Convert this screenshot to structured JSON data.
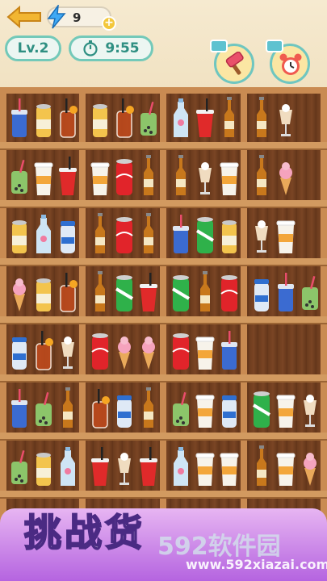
{
  "hud": {
    "energy_count": "9",
    "energy_plus": "+",
    "level": "Lv.2",
    "timer": "9:55"
  },
  "banner": {
    "title": "挑战货",
    "watermark": "592软件园",
    "watermark_url": "www.592xiazai.com"
  },
  "colors": {
    "accent_teal": "#73c9b9",
    "shelf_wood": "#c98b52",
    "banner_purple": "#b564e0"
  },
  "rows": [
    [
      "soda-cup-blue",
      "juice-can",
      "orange-jar",
      "juice-can",
      "orange-jar",
      "matcha-cup",
      "milk-bottle",
      "red-cup",
      "beer-bottle",
      "beer-bottle",
      "latte-glass"
    ],
    [
      "matcha-cup",
      "coffee-cup",
      "red-cup",
      "coffee-cup",
      "cola-can",
      "beer-bottle",
      "beer-bottle",
      "latte-glass",
      "coffee-cup",
      "beer-bottle",
      "icecream-cone"
    ],
    [
      "juice-can",
      "milk-bottle",
      "milk-jar",
      "beer-bottle",
      "cola-can",
      "beer-bottle",
      "soda-cup-blue",
      "green-can",
      "juice-can",
      "latte-glass",
      "coffee-cup"
    ],
    [
      "icecream-cone",
      "juice-can",
      "orange-jar",
      "beer-bottle",
      "green-can",
      "red-cup",
      "green-can",
      "beer-bottle",
      "cola-can",
      "milk-jar",
      "soda-cup-blue",
      "matcha-cup"
    ],
    [
      "milk-jar",
      "orange-jar",
      "latte-glass",
      "cola-can",
      "icecream-cone",
      "icecream-cone",
      "cola-can",
      "coffee-cup",
      "soda-cup-blue"
    ],
    [
      "soda-cup-blue",
      "matcha-cup",
      "beer-bottle",
      "orange-jar",
      "milk-jar",
      "beer-bottle",
      "matcha-cup",
      "coffee-cup",
      "milk-jar",
      "green-can",
      "coffee-cup",
      "latte-glass"
    ],
    [
      "matcha-cup",
      "juice-can",
      "milk-bottle",
      "red-cup",
      "latte-glass",
      "red-cup",
      "milk-bottle",
      "coffee-cup",
      "coffee-cup",
      "beer-bottle",
      "coffee-cup",
      "icecream-cone"
    ]
  ]
}
